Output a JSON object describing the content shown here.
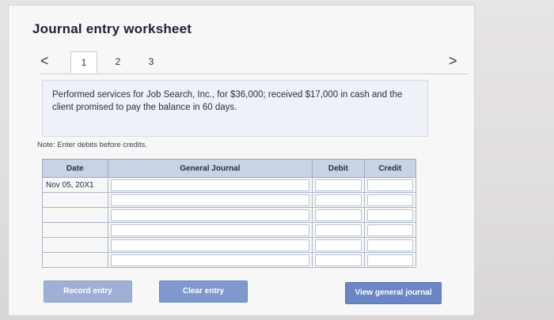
{
  "title": "Journal entry worksheet",
  "tabs": [
    "1",
    "2",
    "3"
  ],
  "nav": {
    "prev_icon": "chevron-left-icon",
    "next_icon": "chevron-right-icon",
    "prev_glyph": "<",
    "next_glyph": ">"
  },
  "prompt": "Performed services for Job Search, Inc., for $36,000; received $17,000 in cash and the client promised to pay the balance in 60 days.",
  "note": "Note: Enter debits before credits.",
  "table": {
    "headers": {
      "date": "Date",
      "general_journal": "General Journal",
      "debit": "Debit",
      "credit": "Credit"
    },
    "rows": [
      {
        "date": "Nov 05, 20X1",
        "account": "",
        "debit": "",
        "credit": ""
      },
      {
        "date": "",
        "account": "",
        "debit": "",
        "credit": ""
      },
      {
        "date": "",
        "account": "",
        "debit": "",
        "credit": ""
      },
      {
        "date": "",
        "account": "",
        "debit": "",
        "credit": ""
      },
      {
        "date": "",
        "account": "",
        "debit": "",
        "credit": ""
      },
      {
        "date": "",
        "account": "",
        "debit": "",
        "credit": ""
      }
    ]
  },
  "buttons": {
    "record": "Record entry",
    "clear": "Clear entry",
    "view": "View general journal"
  }
}
